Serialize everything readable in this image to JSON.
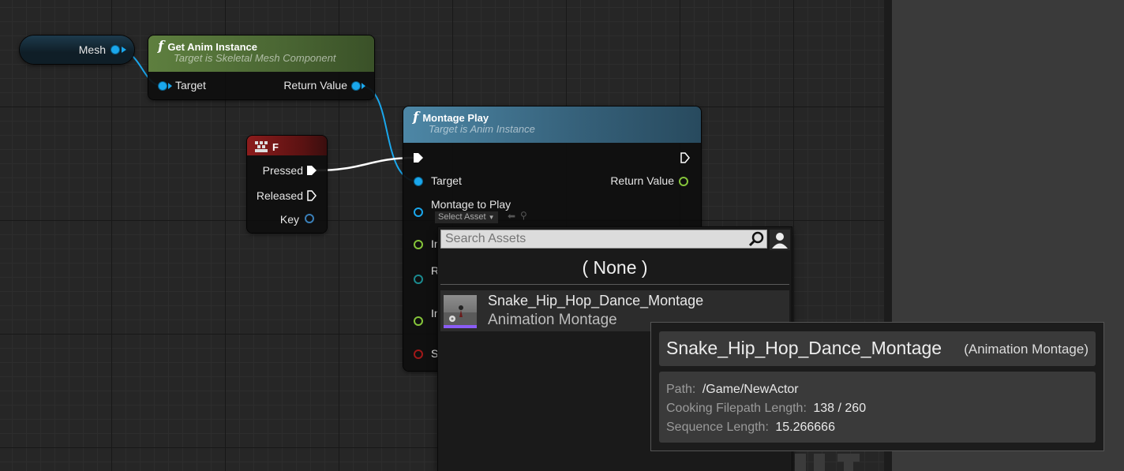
{
  "graph": {
    "mesh_node": {
      "label": "Mesh"
    },
    "get_anim_node": {
      "title": "Get Anim Instance",
      "subtitle": "Target is Skeletal Mesh Component",
      "target_label": "Target",
      "return_label": "Return Value"
    },
    "key_node": {
      "title": "F",
      "pressed_label": "Pressed",
      "released_label": "Released",
      "key_label": "Key"
    },
    "montage_node": {
      "title": "Montage Play",
      "subtitle": "Target is Anim Instance",
      "target_label": "Target",
      "return_label": "Return Value",
      "montage_label": "Montage to Play",
      "select_asset_label": "Select Asset",
      "pin_in_1": "In",
      "pin_r": "R",
      "pin_in_2": "In",
      "pin_s": "S"
    }
  },
  "picker": {
    "search_placeholder": "Search Assets",
    "none_label": "( None )",
    "asset": {
      "name": "Snake_Hip_Hop_Dance_Montage",
      "type": "Animation Montage"
    }
  },
  "tooltip": {
    "name": "Snake_Hip_Hop_Dance_Montage",
    "type": "(Animation Montage)",
    "path_label": "Path:",
    "path_value": "/Game/NewActor",
    "cooking_label": "Cooking Filepath Length:",
    "cooking_value": "138 / 260",
    "sequence_label": "Sequence Length:",
    "sequence_value": "15.266666"
  },
  "colors": {
    "exec_wire": "#ffffff",
    "object_pin": "#1aa7ec",
    "bool_pin": "#85c43a",
    "function_header_green": "#5b7d3d",
    "function_header_blue": "#3f6f88",
    "event_header_red": "#8a1a1a"
  },
  "icons": {
    "function": "function-icon",
    "keyboard": "keyboard-icon",
    "search": "search-icon",
    "user": "user-icon"
  }
}
